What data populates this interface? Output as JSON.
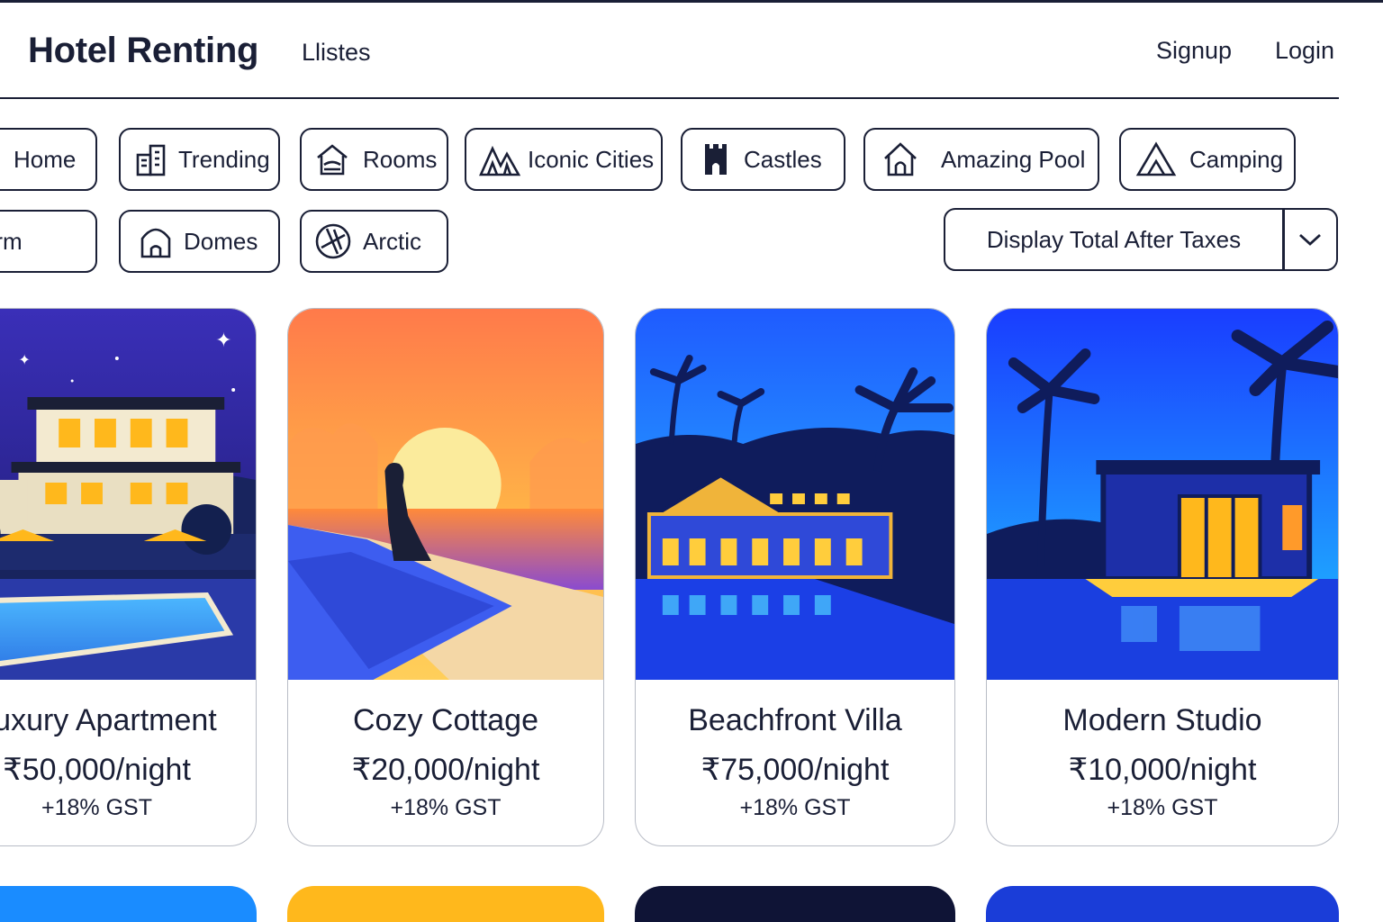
{
  "header": {
    "brand": "Hotel Renting",
    "nav": {
      "listings": "Llistes",
      "signup": "Signup",
      "login": "Login"
    }
  },
  "filters": [
    {
      "label": "Home",
      "icon": "home-icon"
    },
    {
      "label": "Trending",
      "icon": "building-icon"
    },
    {
      "label": "Rooms",
      "icon": "bed-icon"
    },
    {
      "label": "Iconic Cities",
      "icon": "mountain-icon"
    },
    {
      "label": "Castles",
      "icon": "castle-icon"
    },
    {
      "label": "Amazing Pool",
      "icon": "house-icon"
    },
    {
      "label": "Camping",
      "icon": "tent-icon"
    },
    {
      "label": "Farm",
      "icon": "farm-icon"
    },
    {
      "label": "Domes",
      "icon": "dome-icon"
    },
    {
      "label": "Arctic",
      "icon": "snowflake-icon"
    }
  ],
  "tax_toggle": {
    "label": "Display Total After Taxes",
    "icon": "chevron-down-icon"
  },
  "listings": [
    {
      "title": "Luxury Apartment",
      "price": "₹50,000/night",
      "tax": "+18% GST",
      "image": "night-hotel-pool-illustration"
    },
    {
      "title": "Cozy Cottage",
      "price": "₹20,000/night",
      "tax": "+18% GST",
      "image": "sunset-infinity-pool-illustration"
    },
    {
      "title": "Beachfront Villa",
      "price": "₹75,000/night",
      "tax": "+18% GST",
      "image": "palm-villa-pool-illustration"
    },
    {
      "title": "Modern Studio",
      "price": "₹10,000/night",
      "tax": "+18% GST",
      "image": "modern-studio-pool-illustration"
    }
  ],
  "colors": {
    "ink": "#1a1f36",
    "card_border": "#b8bcc6"
  }
}
